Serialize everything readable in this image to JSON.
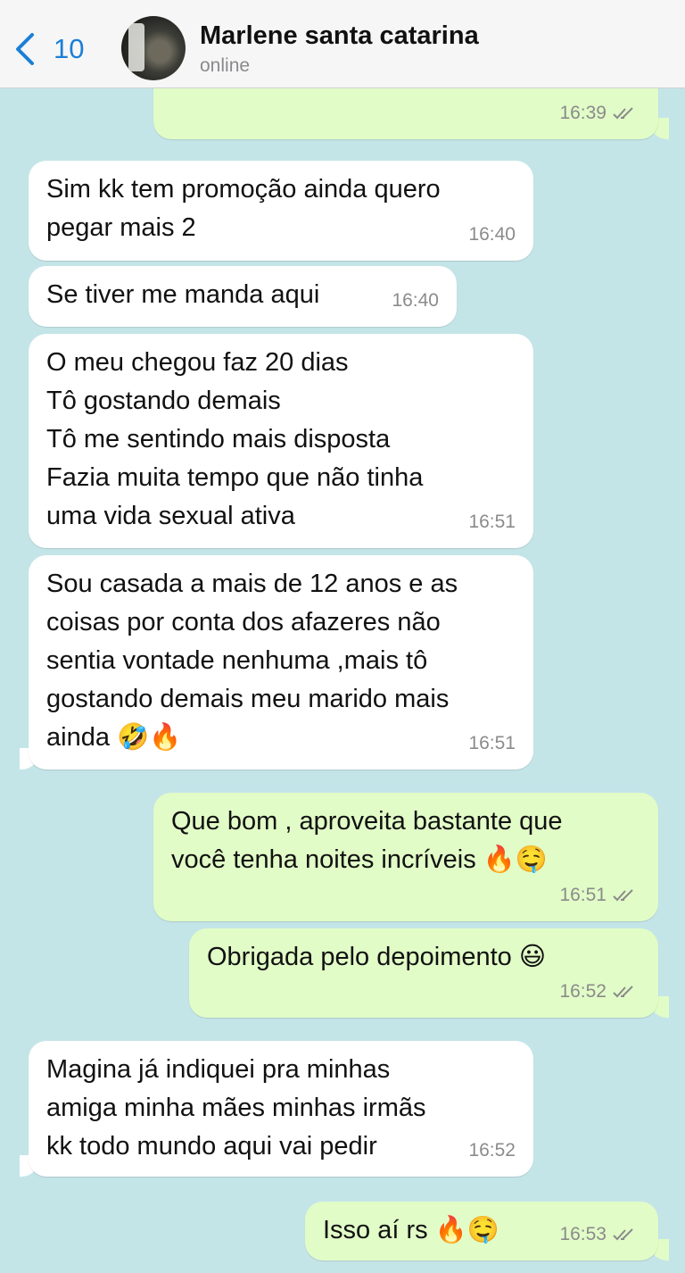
{
  "header": {
    "back_count": "10",
    "contact_name": "Marlene santa catarina",
    "status": "online"
  },
  "messages": [
    {
      "dir": "out",
      "text": "",
      "time": "16:39",
      "read": true
    },
    {
      "dir": "in",
      "text": "Sim kk tem promoção ainda quero\npegar mais 2",
      "time": "16:40"
    },
    {
      "dir": "in",
      "text": "Se tiver me manda aqui",
      "time": "16:40"
    },
    {
      "dir": "in",
      "text": "O meu chegou faz 20 dias\nTô gostando demais\nTô me sentindo mais disposta\nFazia muita tempo que não tinha\numa vida sexual ativa",
      "time": "16:51"
    },
    {
      "dir": "in",
      "text": "Sou casada a mais de 12 anos e as\ncoisas por conta dos afazeres não\nsentia vontade nenhuma ,mais tô\ngostando demais meu marido mais\nainda 🤣🔥",
      "time": "16:51"
    },
    {
      "dir": "out",
      "text": "Que bom , aproveita bastante que\nvocê tenha noites incríveis 🔥🤤",
      "time": "16:51",
      "read": true
    },
    {
      "dir": "out",
      "text": "Obrigada pelo depoimento 😃",
      "time": "16:52",
      "read": true
    },
    {
      "dir": "in",
      "text": "Magina já indiquei pra minhas\namiga minha mães minhas irmãs\nkk todo mundo aqui vai pedir",
      "time": "16:52"
    },
    {
      "dir": "out",
      "text": "Isso aí rs 🔥🤤",
      "time": "16:53",
      "read": true
    }
  ],
  "colors": {
    "background": "#c4e5e8",
    "incoming_bubble": "#ffffff",
    "outgoing_bubble": "#e1fcc7",
    "accent": "#1a7fd6",
    "read_ticks": "#8b8b8b"
  }
}
